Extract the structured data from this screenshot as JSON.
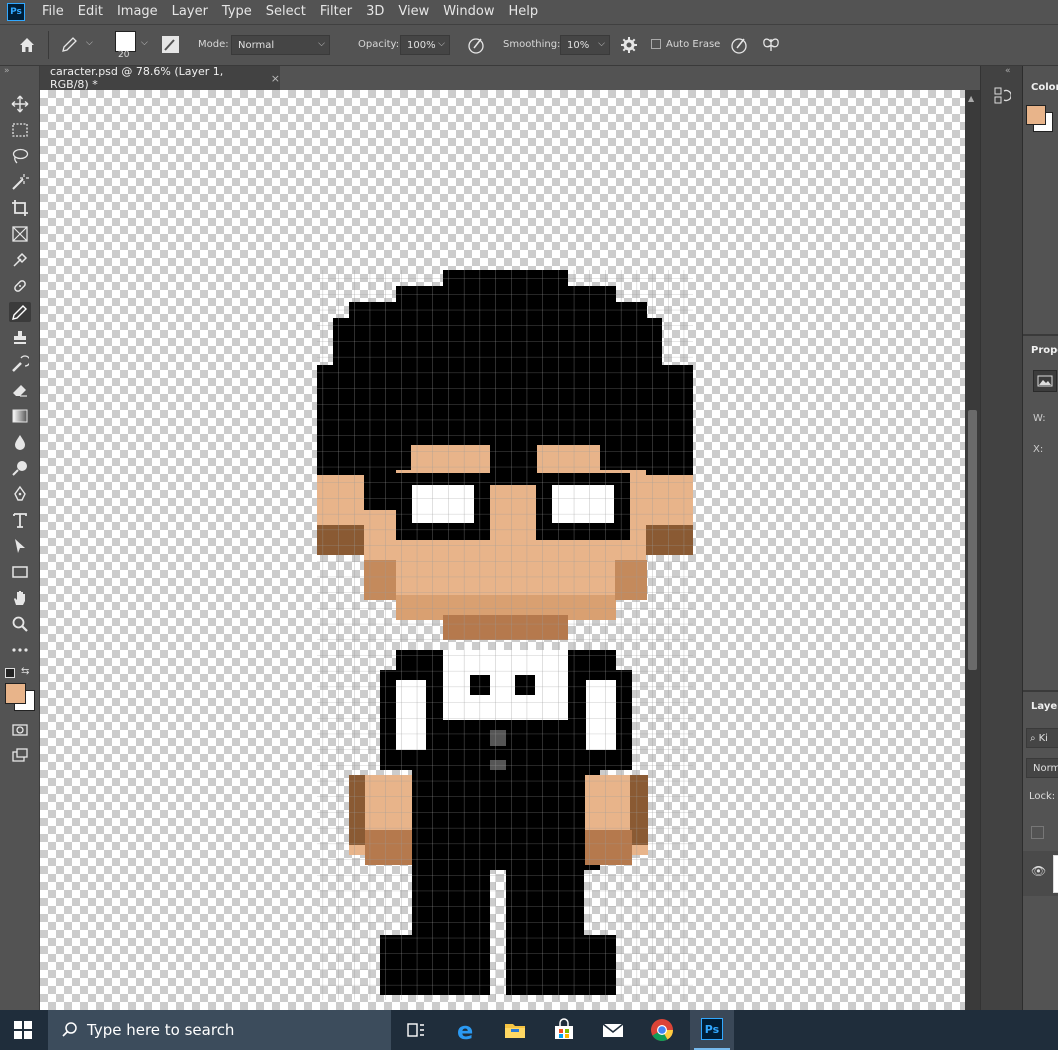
{
  "app": {
    "logo": "Ps"
  },
  "menu": [
    "File",
    "Edit",
    "Image",
    "Layer",
    "Type",
    "Select",
    "Filter",
    "3D",
    "View",
    "Window",
    "Help"
  ],
  "options": {
    "brush_size": "20",
    "mode_label": "Mode:",
    "mode_value": "Normal",
    "opacity_label": "Opacity:",
    "opacity_value": "100%",
    "smoothing_label": "Smoothing:",
    "smoothing_value": "10%",
    "auto_erase_label": "Auto Erase"
  },
  "document": {
    "tab_title": "caracter.psd @ 78.6% (Layer 1, RGB/8) *",
    "close": "×"
  },
  "colors": {
    "foreground": "#e8b48a",
    "background": "#ffffff",
    "ui_bg": "#535353",
    "accent": "#31a8ff"
  },
  "panels": {
    "color_title": "Color",
    "properties_title": "Prope",
    "prop_w": "W:",
    "prop_x": "X:",
    "layers_title": "Layers",
    "layers_kind": "Ki",
    "layers_blend": "Norm",
    "layers_lock": "Lock:"
  },
  "taskbar": {
    "search_placeholder": "Type here to search",
    "ps_label": "Ps"
  },
  "tools": [
    "move-tool",
    "marquee-tool",
    "lasso-tool",
    "magic-wand-tool",
    "crop-tool",
    "frame-tool",
    "eyedropper-tool",
    "healing-brush-tool",
    "pencil-tool",
    "stamp-tool",
    "history-brush-tool",
    "eraser-tool",
    "gradient-tool",
    "blur-tool",
    "dodge-tool",
    "pen-tool",
    "type-tool",
    "path-select-tool",
    "rectangle-tool",
    "hand-tool",
    "zoom-tool",
    "more-tools"
  ]
}
